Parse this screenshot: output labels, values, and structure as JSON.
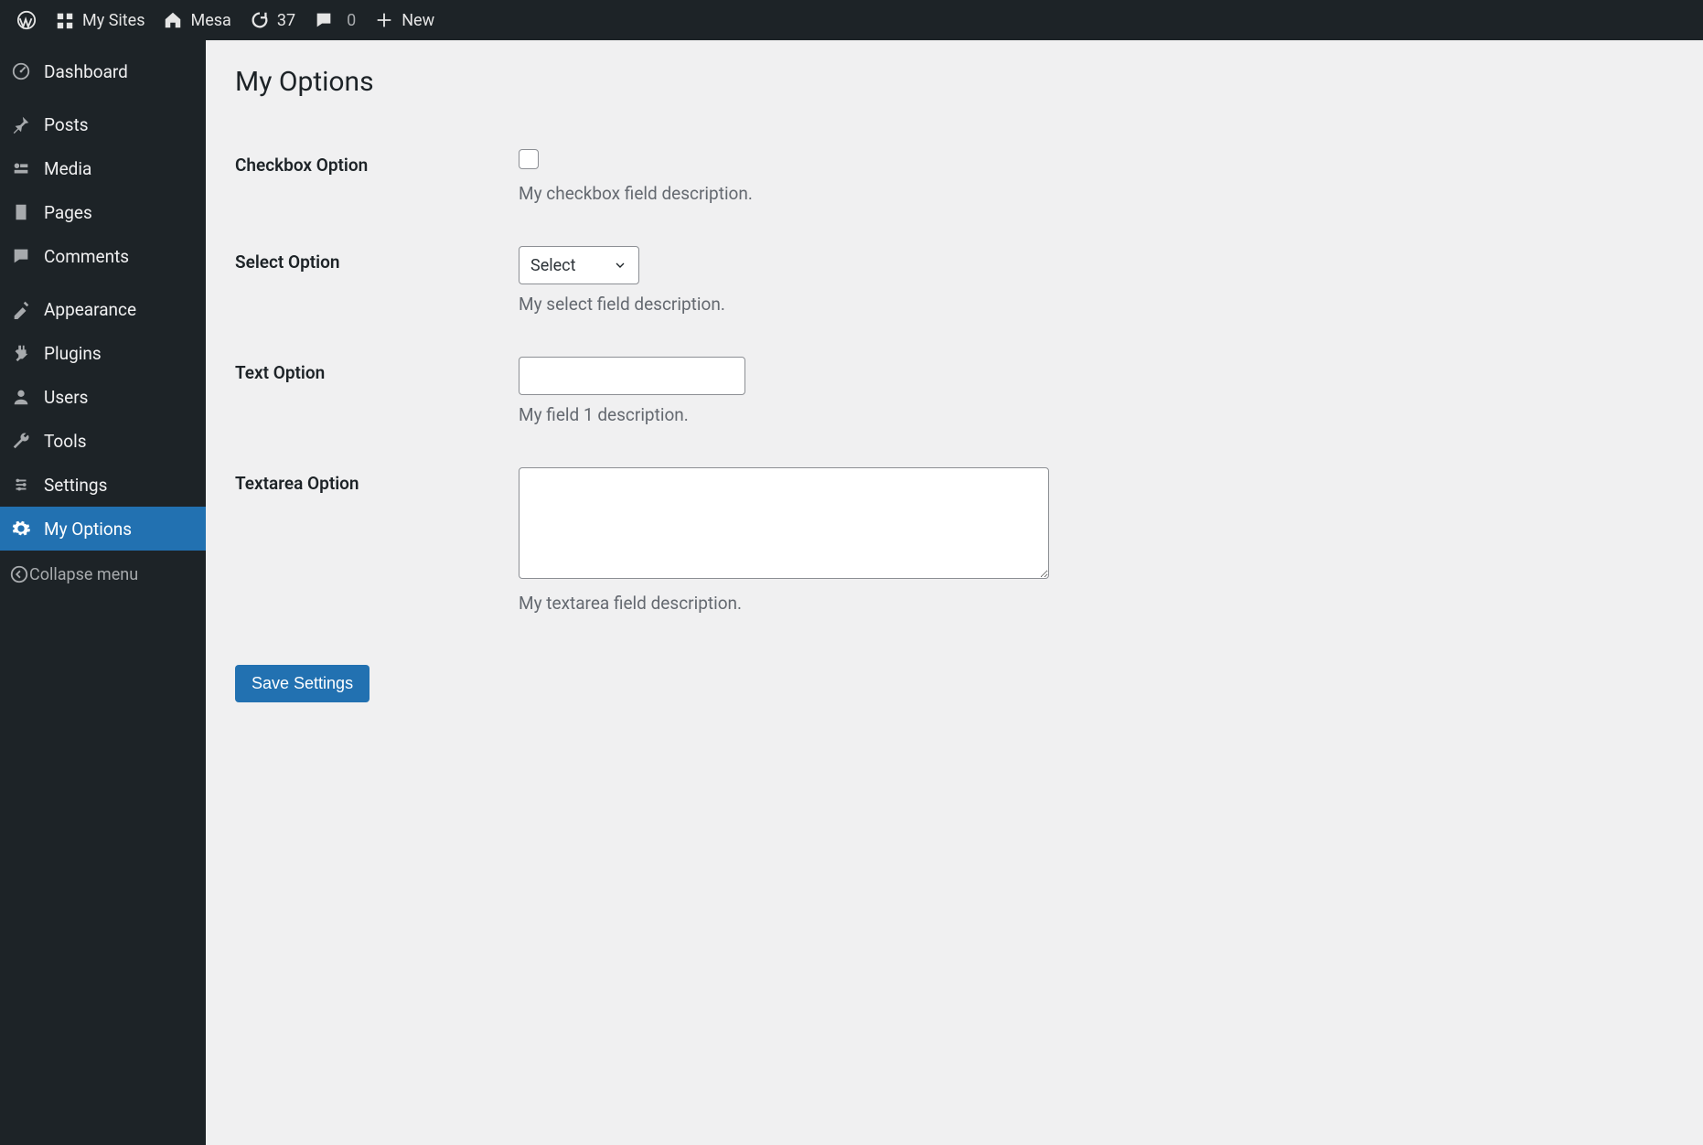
{
  "toolbar": {
    "my_sites_label": "My Sites",
    "site_name": "Mesa",
    "updates_count": "37",
    "comments_count": "0",
    "new_label": "New"
  },
  "sidebar": {
    "items": [
      {
        "icon": "dashboard",
        "label": "Dashboard"
      },
      {
        "icon": "thumbtack",
        "label": "Posts"
      },
      {
        "icon": "media",
        "label": "Media"
      },
      {
        "icon": "page",
        "label": "Pages"
      },
      {
        "icon": "comments",
        "label": "Comments"
      },
      {
        "icon": "appearance",
        "label": "Appearance"
      },
      {
        "icon": "plugins",
        "label": "Plugins"
      },
      {
        "icon": "users",
        "label": "Users"
      },
      {
        "icon": "tools",
        "label": "Tools"
      },
      {
        "icon": "settings",
        "label": "Settings"
      },
      {
        "icon": "gear",
        "label": "My Options",
        "current": true
      }
    ],
    "collapse_label": "Collapse menu"
  },
  "page": {
    "title": "My Options",
    "save_button": "Save Settings",
    "fields": {
      "checkbox": {
        "label": "Checkbox Option",
        "description": "My checkbox field description."
      },
      "select": {
        "label": "Select Option",
        "selected": "Select",
        "description": "My select field description."
      },
      "text": {
        "label": "Text Option",
        "value": "",
        "description": "My field 1 description."
      },
      "textarea": {
        "label": "Textarea Option",
        "value": "",
        "description": "My textarea field description."
      }
    }
  }
}
